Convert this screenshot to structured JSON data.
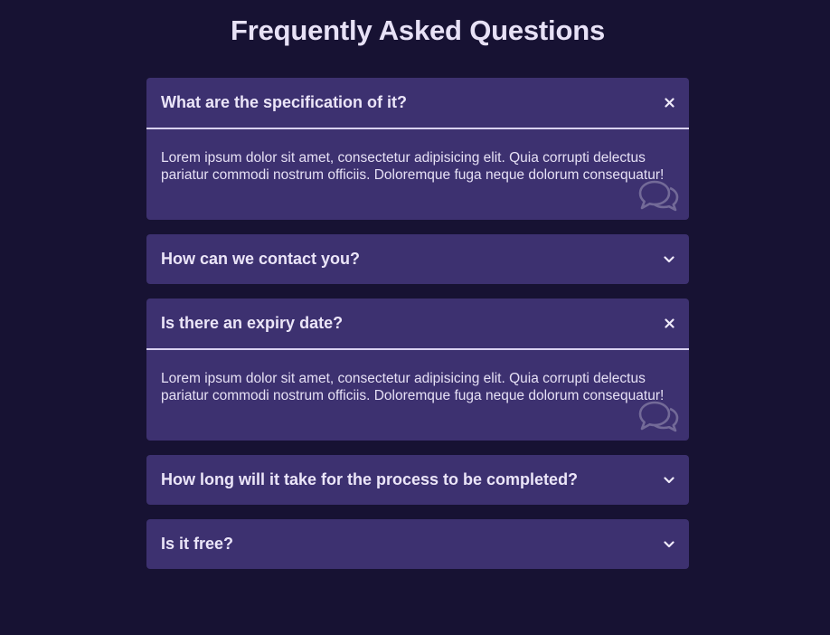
{
  "page": {
    "title": "Frequently Asked Questions"
  },
  "faqs": [
    {
      "question": "What are the specification of it?",
      "answer": "Lorem ipsum dolor sit amet, consectetur adipisicing elit. Quia corrupti delectus pariatur commodi nostrum officiis. Doloremque fuga neque dolorum consequatur!",
      "open": true,
      "toggle_icon": "close-icon"
    },
    {
      "question": "How can we contact you?",
      "answer": "",
      "open": false,
      "toggle_icon": "chevron-down-icon"
    },
    {
      "question": "Is there an expiry date?",
      "answer": "Lorem ipsum dolor sit amet, consectetur adipisicing elit. Quia corrupti delectus pariatur commodi nostrum officiis. Doloremque fuga neque dolorum consequatur!",
      "open": true,
      "toggle_icon": "close-icon"
    },
    {
      "question": "How long will it take for the process to be completed?",
      "answer": "",
      "open": false,
      "toggle_icon": "chevron-down-icon"
    },
    {
      "question": "Is it free?",
      "answer": "",
      "open": false,
      "toggle_icon": "chevron-down-icon"
    }
  ],
  "colors": {
    "background": "#171233",
    "card": "#3d3170",
    "text": "#ebe5f8",
    "divider": "#d9d1f0"
  },
  "decor": {
    "answer_icon": "comments-icon"
  }
}
